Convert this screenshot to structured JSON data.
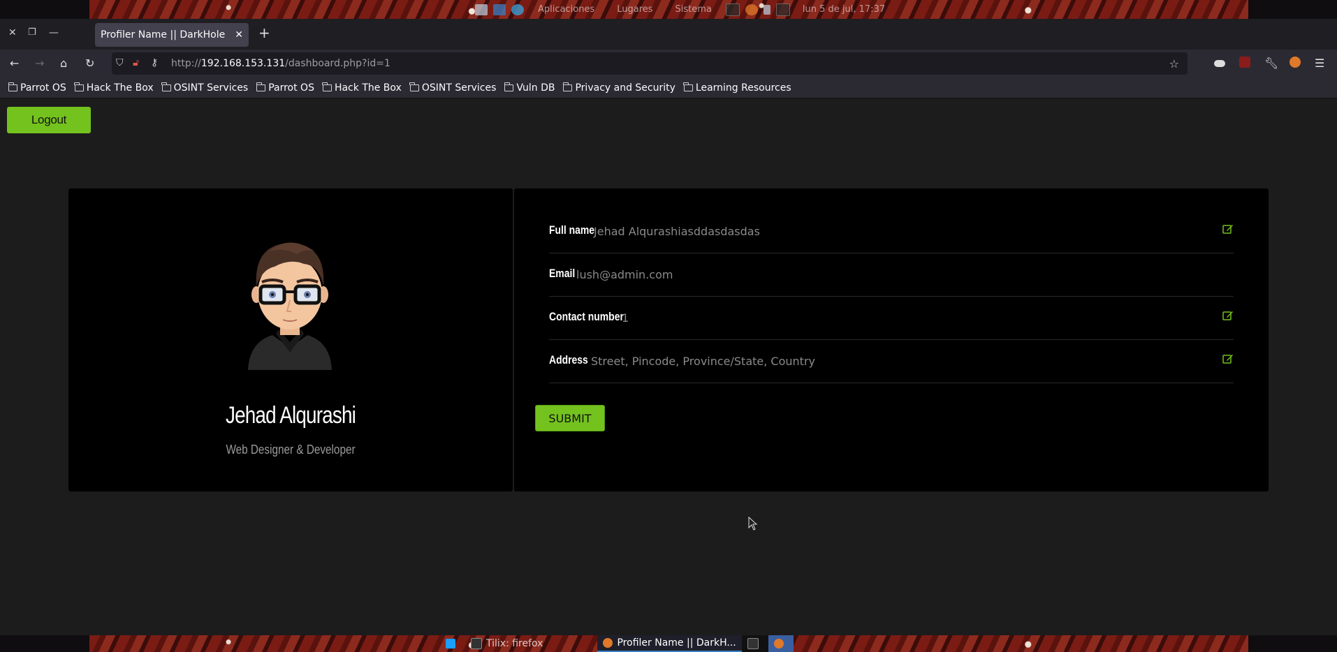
{
  "desktop_panel": {
    "menu_apps": "Aplicaciones",
    "menu_places": "Lugares",
    "menu_system": "Sistema",
    "clock": "lun 5 de jul, 17:37"
  },
  "browser": {
    "tab_title": "Profiler Name || DarkHole",
    "url_prefix": "http://",
    "url_host": "192.168.153.131",
    "url_path": "/dashboard.php?id=1",
    "bookmarks": [
      "Parrot OS",
      "Hack The Box",
      "OSINT Services",
      "Parrot OS",
      "Hack The Box",
      "OSINT Services",
      "Vuln DB",
      "Privacy and Security",
      "Learning Resources"
    ]
  },
  "page": {
    "logout_label": "Logout",
    "profile": {
      "name": "Jehad Alqurashi",
      "role": "Web Designer & Developer"
    },
    "fields": {
      "fullname_label": "Full name",
      "fullname_value": "Jehad Alqurashiasddasdasdas",
      "email_label": "Email",
      "email_value": "lush@admin.com",
      "contact_label": "Contact number",
      "contact_value": "1",
      "address_label": "Address",
      "address_placeholder": "Street, Pincode, Province/State, Country"
    },
    "submit_label": "SUBMIT",
    "accent_color": "#74c21e"
  },
  "taskbar": {
    "items": [
      "Tilix: firefox",
      "Profiler Name || DarkH..."
    ]
  }
}
